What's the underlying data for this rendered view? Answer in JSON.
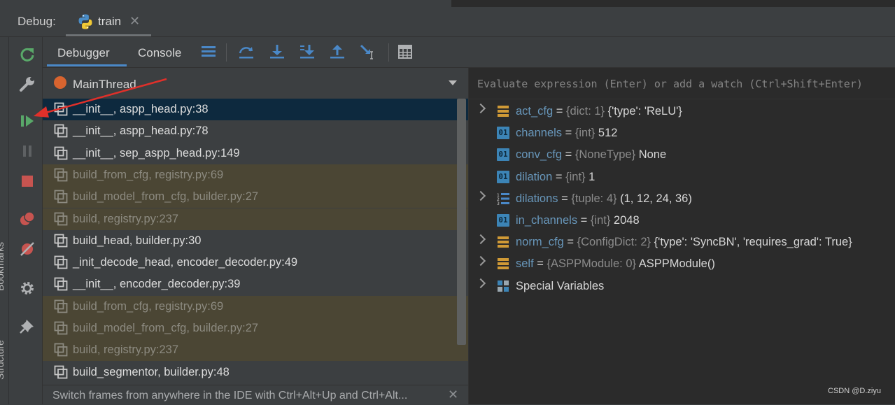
{
  "header": {
    "debug_label": "Debug:",
    "config_tab": "train"
  },
  "left_sidebar": {
    "vertical_labels": [
      "Bookmarks",
      "Structure"
    ]
  },
  "toolbar": {
    "tabs": [
      "Debugger",
      "Console"
    ]
  },
  "frames_panel": {
    "thread": "MainThread",
    "frames": [
      {
        "label": "__init__, aspp_head.py:38",
        "kind": "selected"
      },
      {
        "label": "__init__, aspp_head.py:78",
        "kind": "user"
      },
      {
        "label": "__init__, sep_aspp_head.py:149",
        "kind": "user"
      },
      {
        "label": "build_from_cfg, registry.py:69",
        "kind": "lib"
      },
      {
        "label": "build_model_from_cfg, builder.py:27",
        "kind": "lib"
      },
      {
        "label": "build, registry.py:237",
        "kind": "lib"
      },
      {
        "label": "build_head, builder.py:30",
        "kind": "user"
      },
      {
        "label": "_init_decode_head, encoder_decoder.py:49",
        "kind": "user"
      },
      {
        "label": "__init__, encoder_decoder.py:39",
        "kind": "user"
      },
      {
        "label": "build_from_cfg, registry.py:69",
        "kind": "lib"
      },
      {
        "label": "build_model_from_cfg, builder.py:27",
        "kind": "lib"
      },
      {
        "label": "build, registry.py:237",
        "kind": "lib"
      },
      {
        "label": "build_segmentor, builder.py:48",
        "kind": "user"
      }
    ],
    "hint": "Switch frames from anywhere in the IDE with Ctrl+Alt+Up and Ctrl+Alt..."
  },
  "variables_panel": {
    "eval_placeholder": "Evaluate expression (Enter) or add a watch (Ctrl+Shift+Enter)",
    "variables": [
      {
        "name": "act_cfg",
        "eq": " = ",
        "type": "{dict: 1}",
        "value": " {'type': 'ReLU'}",
        "icon": "dict",
        "expandable": true
      },
      {
        "name": "channels",
        "eq": " = ",
        "type": "{int}",
        "value": " 512",
        "icon": "int",
        "expandable": false
      },
      {
        "name": "conv_cfg",
        "eq": " = ",
        "type": "{NoneType}",
        "value": " None",
        "icon": "int",
        "expandable": false
      },
      {
        "name": "dilation",
        "eq": " = ",
        "type": "{int}",
        "value": " 1",
        "icon": "int",
        "expandable": false
      },
      {
        "name": "dilations",
        "eq": " = ",
        "type": "{tuple: 4}",
        "value": " (1, 12, 24, 36)",
        "icon": "list",
        "expandable": true
      },
      {
        "name": "in_channels",
        "eq": " = ",
        "type": "{int}",
        "value": " 2048",
        "icon": "int",
        "expandable": false
      },
      {
        "name": "norm_cfg",
        "eq": " = ",
        "type": "{ConfigDict: 2}",
        "value": " {'type': 'SyncBN', 'requires_grad': True}",
        "icon": "dict",
        "expandable": true
      },
      {
        "name": "self",
        "eq": " = ",
        "type": "{ASPPModule: 0}",
        "value": " ASPPModule()",
        "icon": "dict",
        "expandable": true
      },
      {
        "name": "",
        "eq": "",
        "type": "",
        "value": "Special Variables",
        "icon": "special",
        "expandable": true
      }
    ]
  },
  "watermark": "CSDN @D.ziyu",
  "colors": {
    "selected_row": "#0d293e",
    "library_row": "#4b4634",
    "var_name": "#6897bb",
    "accent": "#4a88c7",
    "thread_dot": "#d8642f",
    "annotation_arrow": "#e0302a"
  }
}
